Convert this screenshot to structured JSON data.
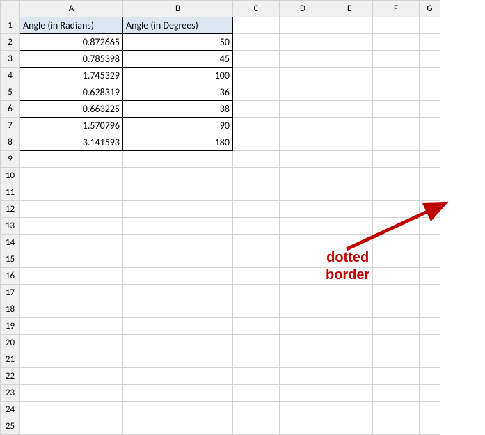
{
  "columns": [
    "A",
    "B",
    "C",
    "D",
    "E",
    "F",
    "G"
  ],
  "row_count": 25,
  "headers": {
    "A": "Angle (in Radians)",
    "B": "Angle (in Degrees)"
  },
  "rows": [
    {
      "A": "0.872665",
      "B": "50"
    },
    {
      "A": "0.785398",
      "B": "45"
    },
    {
      "A": "1.745329",
      "B": "100"
    },
    {
      "A": "0.628319",
      "B": "36"
    },
    {
      "A": "0.663225",
      "B": "38"
    },
    {
      "A": "1.570796",
      "B": "90"
    },
    {
      "A": "3.141593",
      "B": "180"
    }
  ],
  "print_area": {
    "last_col": "F",
    "last_row": 22
  },
  "annotation": {
    "line1": "dotted",
    "line2": "border"
  }
}
